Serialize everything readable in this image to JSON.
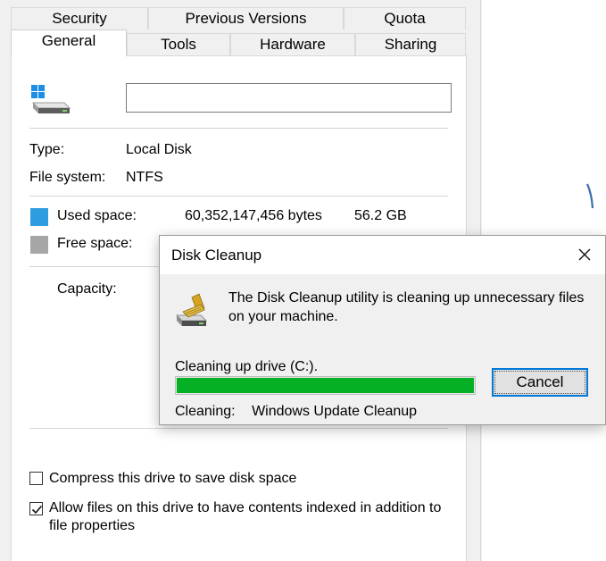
{
  "properties": {
    "tabs_top": [
      "Security",
      "Previous Versions",
      "Quota"
    ],
    "tabs_bottom": [
      "General",
      "Tools",
      "Hardware",
      "Sharing"
    ],
    "active_tab": "General",
    "drive_name_value": "",
    "type_label": "Type:",
    "type_value": "Local Disk",
    "fs_label": "File system:",
    "fs_value": "NTFS",
    "used_label": "Used space:",
    "used_bytes": "60,352,147,456 bytes",
    "used_gb": "56.2 GB",
    "free_label": "Free space:",
    "capacity_label": "Capacity:",
    "compress_label": "Compress this drive to save disk space",
    "compress_checked": false,
    "index_label_line1": "Allow files on this drive to have contents indexed in addition to",
    "index_label_line2": "file properties",
    "index_checked": true,
    "colors": {
      "used": "#2e9de0",
      "free": "#a6a6a6"
    }
  },
  "cleanup_dialog": {
    "title": "Disk Cleanup",
    "message_line1": "The Disk Cleanup utility is cleaning up unnecessary files",
    "message_line2": "on your machine.",
    "drive_text": "Cleaning up drive  (C:).",
    "progress_fraction": 1.0,
    "progress_color": "#06b025",
    "cleaning_label": "Cleaning:",
    "cleaning_item": "Windows Update Cleanup",
    "cancel_label": "Cancel",
    "close_icon": "close-icon"
  }
}
